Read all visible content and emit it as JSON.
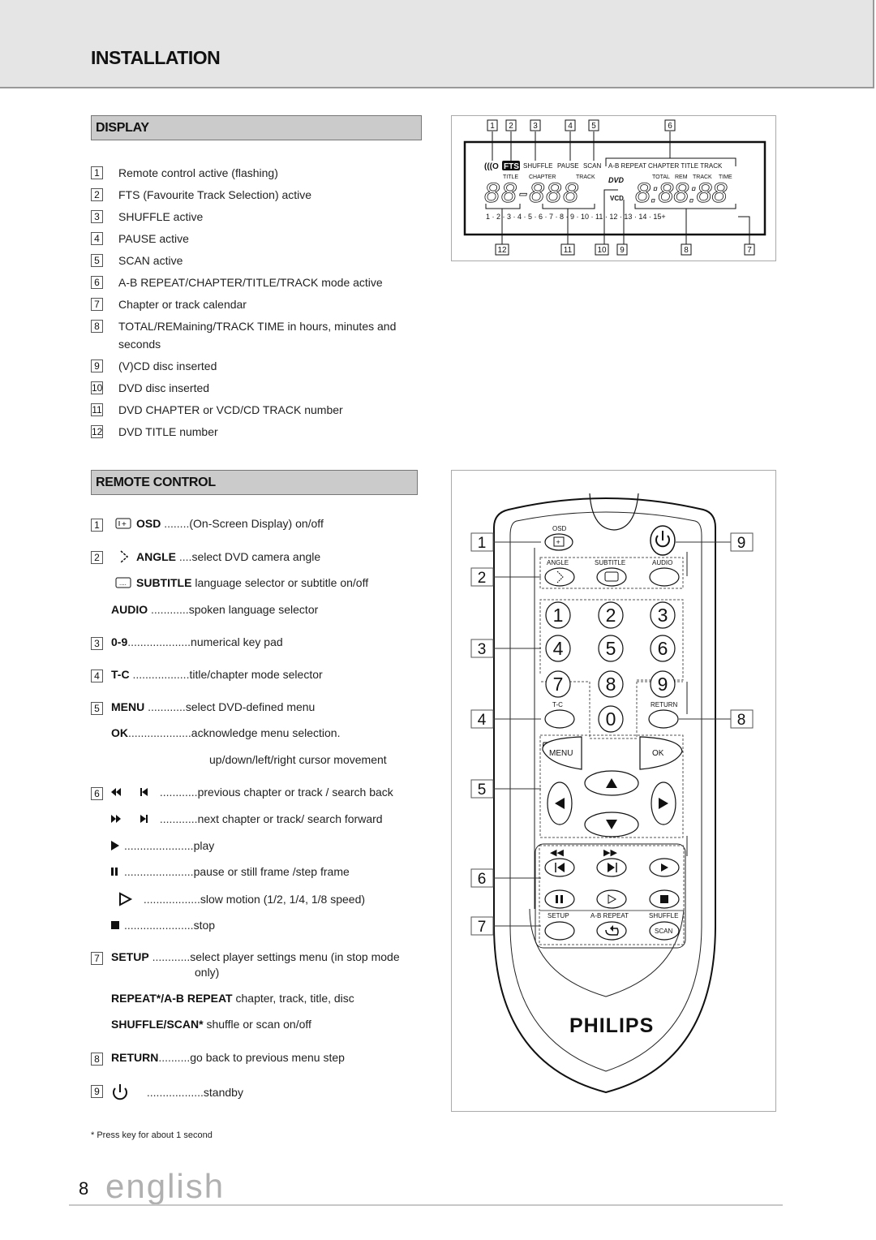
{
  "header": {
    "title": "INSTALLATION"
  },
  "display_section": {
    "title": "DISPLAY",
    "items": [
      {
        "num": "1",
        "text": "Remote control active (flashing)"
      },
      {
        "num": "2",
        "text": "FTS (Favourite Track Selection) active"
      },
      {
        "num": "3",
        "text": "SHUFFLE active"
      },
      {
        "num": "4",
        "text": "PAUSE active"
      },
      {
        "num": "5",
        "text": "SCAN active"
      },
      {
        "num": "6",
        "text": "A-B REPEAT/CHAPTER/TITLE/TRACK mode active"
      },
      {
        "num": "7",
        "text": "Chapter or track calendar"
      },
      {
        "num": "8",
        "text": "TOTAL/REMaining/TRACK TIME in hours, minutes and",
        "text2": "seconds"
      },
      {
        "num": "9",
        "text": "(V)CD disc inserted"
      },
      {
        "num": "10",
        "text": "DVD disc inserted"
      },
      {
        "num": "11",
        "text": "DVD CHAPTER or VCD/CD TRACK number"
      },
      {
        "num": "12",
        "text": "DVD TITLE number"
      }
    ]
  },
  "display_figure": {
    "top_callouts": [
      "1",
      "2",
      "3",
      "4",
      "5",
      "6"
    ],
    "bottom_callouts": [
      "12",
      "11",
      "10",
      "9",
      "8",
      "7"
    ],
    "indicators": {
      "remote": "(((O",
      "fts": "FTS",
      "shuffle": "SHUFFLE",
      "pause": "PAUSE",
      "scan": "SCAN",
      "mode": "A-B  REPEAT CHAPTER  TITLE  TRACK"
    },
    "labels": {
      "title": "TITLE",
      "chapter": "CHAPTER",
      "track": "TRACK",
      "total": "TOTAL",
      "rem": "REM",
      "track2": "TRACK",
      "time": "TIME",
      "dvd": "DVD",
      "vcd": "VCD"
    },
    "segments_left": "88-888",
    "segments_right": "8:88:88",
    "calendar": "1 · 2 · 3 · 4 · 5 · 6 · 7 · 8 · 9 · 10 · 11 · 12 · 13 · 14 · 15+"
  },
  "remote_section": {
    "title": "REMOTE CONTROL",
    "rows": [
      {
        "num": "1",
        "icon": "osd-icon",
        "key": "OSD",
        "dots": " ........",
        "desc": "(On-Screen Display) on/off"
      },
      {
        "num": "2",
        "icon": "angle-icon",
        "key": "ANGLE",
        "dots": " ....",
        "desc": "select DVD camera angle"
      },
      {
        "num": "",
        "icon": "subtitle-icon",
        "key": "SUBTITLE",
        "dots": " ",
        "desc": "language selector or subtitle on/off"
      },
      {
        "num": "",
        "icon": "",
        "key": "AUDIO",
        "dots": " ............",
        "desc": "spoken language selector"
      },
      {
        "num": "3",
        "icon": "",
        "key": "0-9",
        "dots": "....................",
        "desc": "numerical key pad"
      },
      {
        "num": "4",
        "icon": "",
        "key": "T-C",
        "dots": " ..................",
        "desc": "title/chapter mode selector"
      },
      {
        "num": "5",
        "icon": "",
        "key": "MENU",
        "dots": " ............",
        "desc": "select DVD-defined menu"
      },
      {
        "num": "",
        "icon": "",
        "key": "OK",
        "dots": "....................",
        "desc": "acknowledge menu selection."
      },
      {
        "num": "",
        "icon": "",
        "key": "",
        "dots": "",
        "desc": "up/down/left/right cursor movement"
      },
      {
        "num": "6",
        "icon": "prev-icons",
        "key": "",
        "dots": " ............",
        "desc": "previous chapter or track / search back"
      },
      {
        "num": "",
        "icon": "next-icons",
        "key": "",
        "dots": " ............",
        "desc": "next chapter or track/ search forward"
      },
      {
        "num": "",
        "icon": "play-icon",
        "key": "",
        "dots": "......................",
        "desc": "play"
      },
      {
        "num": "",
        "icon": "pause-icon",
        "key": "",
        "dots": "......................",
        "desc": "pause or still frame /step frame"
      },
      {
        "num": "",
        "icon": "slow-icon",
        "key": "",
        "dots": " ..................",
        "desc": "slow motion (1/2, 1/4, 1/8 speed)"
      },
      {
        "num": "",
        "icon": "stop-icon",
        "key": "",
        "dots": "......................",
        "desc": "stop"
      },
      {
        "num": "7",
        "icon": "",
        "key": "SETUP",
        "dots": " ............",
        "desc": "select player settings menu (in stop mode",
        "desc2": "only)"
      },
      {
        "num": "",
        "icon": "",
        "key": "REPEAT*/A-B REPEAT",
        "dots": " ",
        "desc": "chapter, track, title, disc"
      },
      {
        "num": "",
        "icon": "",
        "key": "SHUFFLE/SCAN*",
        "dots": "  ",
        "desc": "shuffle or scan on/off"
      },
      {
        "num": "8",
        "icon": "",
        "key": "RETURN",
        "dots": "..........",
        "desc": "go back to previous menu step"
      },
      {
        "num": "9",
        "icon": "power-icon",
        "key": "",
        "dots": " ..................",
        "desc": "standby"
      }
    ],
    "footnote": "*  Press key for about 1 second"
  },
  "remote_figure": {
    "callouts_left": [
      "1",
      "2",
      "3",
      "4",
      "5",
      "6",
      "7"
    ],
    "callouts_right": [
      "9",
      "8"
    ],
    "labels": {
      "osd": "OSD",
      "angle": "ANGLE",
      "subtitle": "SUBTITLE",
      "audio": "AUDIO",
      "tc": "T-C",
      "return": "RETURN",
      "menu": "MENU",
      "ok": "OK",
      "setup": "SETUP",
      "ab_repeat": "A-B REPEAT",
      "shuffle": "SHUFFLE",
      "scan": "SCAN",
      "brand": "PHILIPS"
    },
    "digits": [
      "1",
      "2",
      "3",
      "4",
      "5",
      "6",
      "7",
      "8",
      "9",
      "0"
    ]
  },
  "footer": {
    "page": "8",
    "language": "english"
  }
}
